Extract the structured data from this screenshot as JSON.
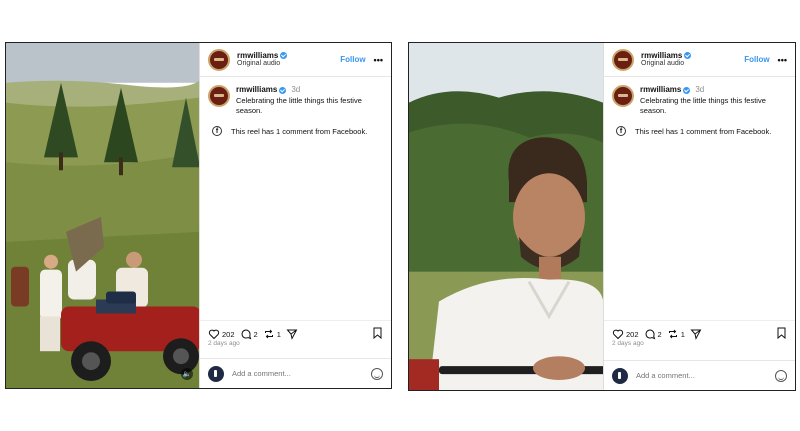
{
  "posts": [
    {
      "header": {
        "username": "rmwilliams",
        "subtitle": "Original audio",
        "follow_label": "Follow",
        "more_label": "•••"
      },
      "caption": {
        "username": "rmwilliams",
        "age": "3d",
        "text": "Celebrating the little things this festive season."
      },
      "facebook_note": "This reel has 1 comment from Facebook.",
      "stats": {
        "likes": "202",
        "comments": "2",
        "reposts": "1"
      },
      "posted": "2 days ago",
      "comment_placeholder": "Add a comment..."
    },
    {
      "header": {
        "username": "rmwilliams",
        "subtitle": "Original audio",
        "follow_label": "Follow",
        "more_label": "•••"
      },
      "caption": {
        "username": "rmwilliams",
        "age": "3d",
        "text": "Celebrating the little things this festive season."
      },
      "facebook_note": "This reel has 1 comment from Facebook.",
      "stats": {
        "likes": "202",
        "comments": "2",
        "reposts": "1"
      },
      "posted": "2 days ago",
      "comment_placeholder": "Add a comment..."
    }
  ],
  "icons": {
    "facebook": "f",
    "mute": "🔈"
  },
  "colors": {
    "link_blue": "#3897f0",
    "verified_blue": "#3897f0",
    "avatar_brand": "#6b1f12"
  }
}
